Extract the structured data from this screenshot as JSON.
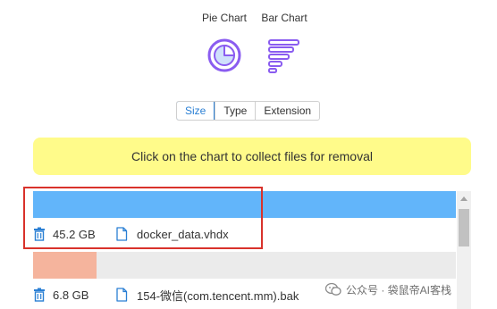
{
  "chart_modes": [
    {
      "label": "Pie Chart",
      "icon": "pie-chart-icon"
    },
    {
      "label": "Bar Chart",
      "icon": "bar-chart-icon"
    }
  ],
  "sort_tabs": [
    {
      "label": "Size",
      "active": true
    },
    {
      "label": "Type",
      "active": false
    },
    {
      "label": "Extension",
      "active": false
    }
  ],
  "hint": "Click on the chart to collect files for removal",
  "files": [
    {
      "size": "45.2 GB",
      "name": "docker_data.vhdx",
      "bar_fraction": 1.0,
      "color": "#62b5fa"
    },
    {
      "size": "6.8 GB",
      "name": "154-微信(com.tencent.mm).bak",
      "bar_fraction": 0.151,
      "color": "#f5b49d"
    }
  ],
  "watermark": "公众号 · 袋鼠帝AI客栈",
  "colors": {
    "accent": "#2a7fd4",
    "hint_bg": "#fffb8a",
    "icon_purple": "#8a5cf0",
    "highlight": "#d9322b"
  }
}
